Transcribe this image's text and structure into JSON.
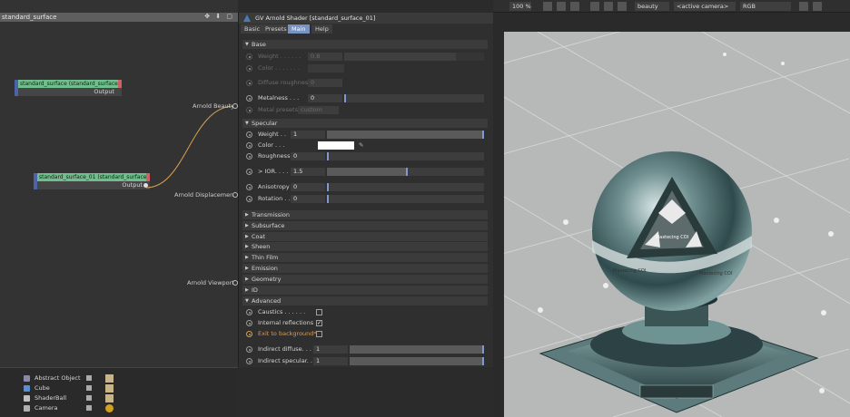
{
  "node_editor": {
    "title": "standard_surface",
    "node1": {
      "title": "standard_surface (standard_surface)",
      "output": "Output"
    },
    "node2": {
      "title": "standard_surface_01 (standard_surface)",
      "output": "Output"
    },
    "ports": {
      "beauty": "Arnold Beauty",
      "displacement": "Arnold Displacement",
      "viewport": "Arnold Viewport"
    }
  },
  "objects": [
    {
      "name": "Abstract Object",
      "icon_color": "#8a8aa0"
    },
    {
      "name": "Cube",
      "icon_color": "#5a8fd0"
    },
    {
      "name": "ShaderBall",
      "icon_color": "#c0c0c0"
    },
    {
      "name": "Camera",
      "icon_color": "#b0b0b0"
    }
  ],
  "attr_panel": {
    "title": "GV Arnold Shader [standard_surface_01]",
    "tabs": [
      "Basic",
      "Presets",
      "Main",
      "Help"
    ],
    "active_tab": "Main",
    "base": {
      "section": "Base",
      "weight": {
        "label": "Weight . . . . . .",
        "value": "0.8"
      },
      "color": {
        "label": "Color . . . . . . ."
      },
      "diffuse_roughness": {
        "label": "Diffuse roughness",
        "value": "0"
      },
      "metalness": {
        "label": "Metalness . . .",
        "value": "0"
      },
      "metal_presets": {
        "label": "Metal presets",
        "value": "custom"
      }
    },
    "specular": {
      "section": "Specular",
      "weight": {
        "label": "Weight . .",
        "value": "1"
      },
      "color": {
        "label": "Color . . ."
      },
      "roughness": {
        "label": "Roughness",
        "value": "0"
      },
      "ior": {
        "label": "> IOR. . . .",
        "value": "1.5"
      },
      "anisotropy": {
        "label": "Anisotropy",
        "value": "0"
      },
      "rotation": {
        "label": "Rotation . .",
        "value": "0"
      }
    },
    "collapsed_sections": [
      "Transmission",
      "Subsurface",
      "Coat",
      "Sheen",
      "Thin Film",
      "Emission",
      "Geometry",
      "ID"
    ],
    "advanced": {
      "section": "Advanced",
      "caustics": {
        "label": "Caustics . . . . . .",
        "checked": false
      },
      "internal_reflections": {
        "label": "Internal reflections",
        "checked": true
      },
      "exit_to_background": {
        "label": "Exit to background*",
        "checked": false
      },
      "indirect_diffuse": {
        "label": "Indirect diffuse. . .",
        "value": "1"
      },
      "indirect_specular": {
        "label": "Indirect specular. .",
        "value": "1"
      }
    }
  },
  "viewport_toolbar": {
    "zoom": "100 %",
    "aov": "beauty",
    "camera": "<active camera>",
    "color_space": "RGB"
  },
  "render": {
    "band_text": "Maxtecing COI",
    "cap_text": "Maxtecing COI"
  }
}
